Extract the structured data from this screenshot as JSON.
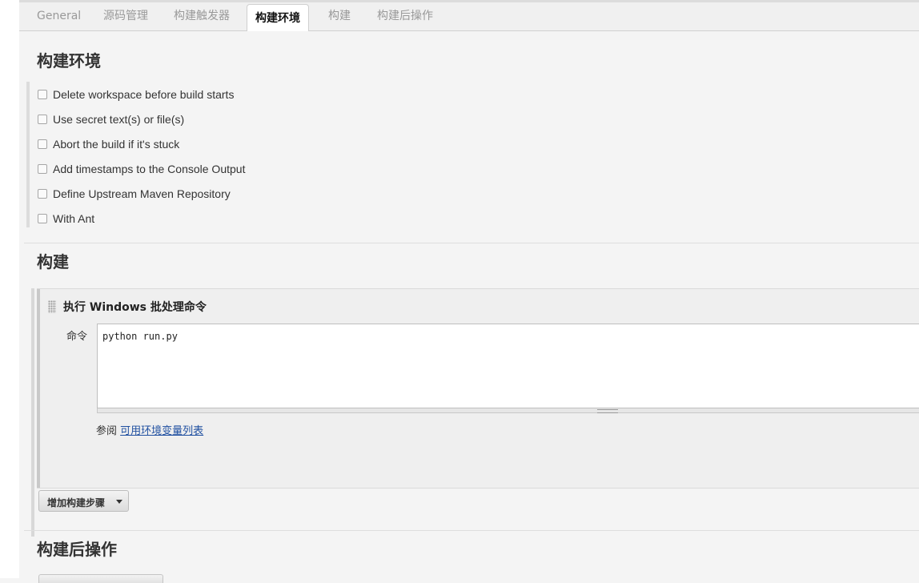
{
  "tabs": [
    {
      "label": "General"
    },
    {
      "label": "源码管理"
    },
    {
      "label": "构建触发器"
    },
    {
      "label": "构建环境"
    },
    {
      "label": "构建"
    },
    {
      "label": "构建后操作"
    }
  ],
  "build_env": {
    "title": "构建环境",
    "options": [
      {
        "label": "Delete workspace before build starts",
        "checked": false
      },
      {
        "label": "Use secret text(s) or file(s)",
        "checked": false
      },
      {
        "label": "Abort the build if it's stuck",
        "checked": false
      },
      {
        "label": "Add timestamps to the Console Output",
        "checked": false
      },
      {
        "label": "Define Upstream Maven Repository",
        "checked": false
      },
      {
        "label": "With Ant",
        "checked": false
      }
    ]
  },
  "build": {
    "title": "构建",
    "step": {
      "title": "执行 Windows 批处理命令",
      "command_label": "命令",
      "command_value": "python run.py",
      "see_also_prefix": "参阅 ",
      "see_also_link": "可用环境变量列表"
    },
    "add_step_label": "增加构建步骤"
  },
  "post_build": {
    "title": "构建后操作"
  }
}
